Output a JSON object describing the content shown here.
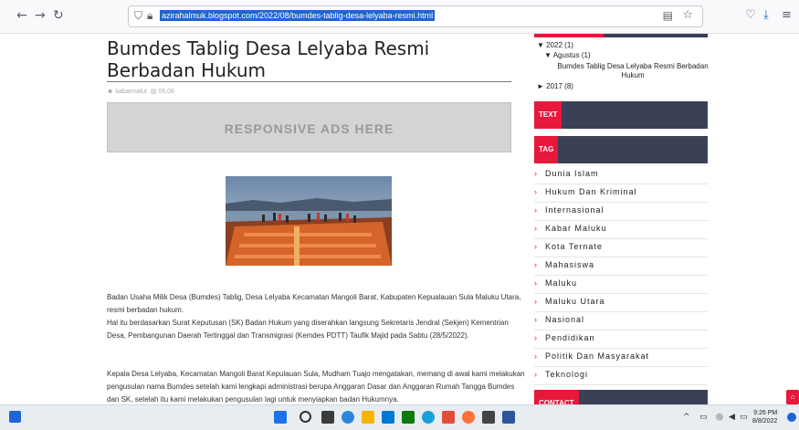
{
  "browser": {
    "url": "azirahalmuk.blogspot.com/2022/08/bumdes-tablig-desa-lelyaba-resmi.html",
    "back_icon": "arrow-left-icon",
    "forward_icon": "arrow-right-icon",
    "reload_icon": "reload-icon"
  },
  "post": {
    "title": "Bumdes Tablig Desa Lelyaba Resmi Berbadan Hukum",
    "author": "kabarmalut",
    "date": "05.08",
    "ads_label": "RESPONSIVE ADS HERE",
    "paragraphs": [
      "Badan Usaha Milik Desa (Bumdes) Tablig, Desa Lelyaba Kecamatan Mangoli Barat, Kabupaten Kepualauan Sula Maluku Utara, resmi berbadan hukum.",
      "Hal itu berdasarkan Surat Keputusan (SK) Badan Hukum yang diserahkan langsung Sekretaris Jendral (Sekjen) Kementrian Desa, Pembangunan Daerah Tertinggal dan Transmigrasi (Kemdes PDTT) Taufik Majid pada Sabtu (28/5/2022).",
      "Kepala Desa Lelyaba, Kecamatan Mangoli Barat Kepulauan Sula, Mudham Tuajo mengatakan, memang di awal kami melakukan pengusulan nama Bumdes setelah kami lengkapi administrasi berupa Anggaran Dasar dan Anggaran Rumah Tangga Bumdes dan SK, setelah itu kami melakukan pengusulan lagi untuk menyiapkan badan Hukumnya."
    ]
  },
  "sidebar": {
    "archive": {
      "year_2022": "2022",
      "count_2022": "(1)",
      "month": "Agustus",
      "month_count": "(1)",
      "post_link": "Bumdes Tablig Desa Lelyaba Resmi Berbadan Hukum",
      "year_2017": "2017",
      "count_2017": "(8)"
    },
    "text_label": "TEXT",
    "tag_label": "TAG",
    "contact_label": "CONTACT",
    "tags": [
      "Dunia Islam",
      "Hukum Dan Kriminal",
      "Internasional",
      "Kabar Maluku",
      "Kota Ternate",
      "Mahasiswa",
      "Maluku",
      "Maluku Utara",
      "Nasional",
      "Pendidikan",
      "Politik Dan Masyarakat",
      "Teknologi"
    ]
  },
  "taskbar": {
    "time": "9:26 PM",
    "date": "8/8/2022"
  },
  "colors": {
    "accent": "#e8173c",
    "widget_bg": "#3a4055"
  }
}
